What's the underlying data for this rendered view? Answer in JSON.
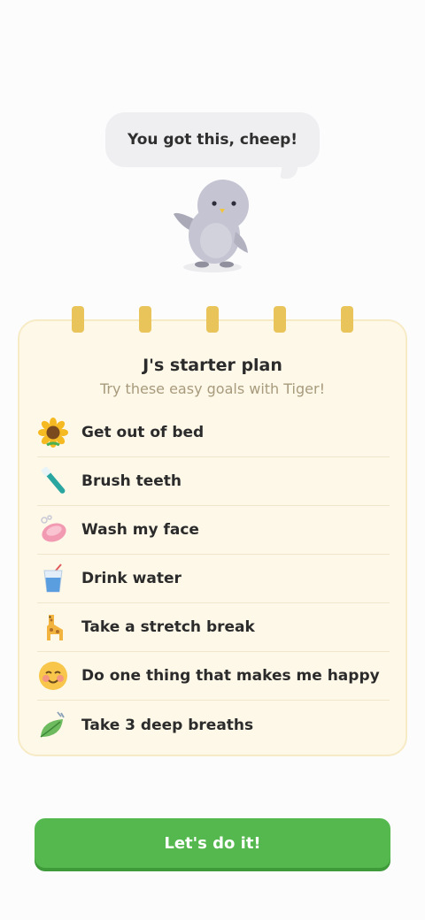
{
  "speech_bubble": {
    "text": "You got this, cheep!"
  },
  "mascot": {
    "icon": "bird-mascot-icon"
  },
  "plan": {
    "title": "J's starter plan",
    "subtitle": "Try these easy goals with Tiger!",
    "goals": [
      {
        "label": "Get out of bed",
        "icon": "sunflower-icon"
      },
      {
        "label": "Brush teeth",
        "icon": "toothbrush-icon"
      },
      {
        "label": "Wash my face",
        "icon": "soap-icon"
      },
      {
        "label": "Drink water",
        "icon": "water-glass-icon"
      },
      {
        "label": "Take a stretch break",
        "icon": "giraffe-icon"
      },
      {
        "label": "Do one thing that makes me happy",
        "icon": "smiling-face-icon"
      },
      {
        "label": "Take 3 deep breaths",
        "icon": "leaf-wind-icon"
      }
    ]
  },
  "cta": {
    "label": "Let's do it!"
  },
  "colors": {
    "background": "#fcfcfd",
    "bubble": "#efeff2",
    "pad": "#fef8e8",
    "pad_border": "#f7ebc6",
    "rings": "#e9c45a",
    "subtitle": "#a89a7c",
    "button": "#55b84f",
    "button_shadow": "#3f9a3a"
  }
}
